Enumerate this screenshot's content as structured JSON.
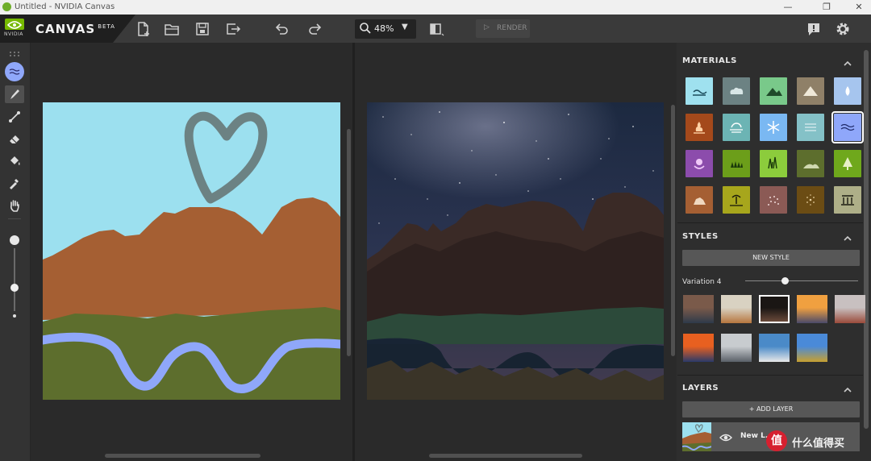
{
  "window": {
    "title": "Untitled - NVIDIA Canvas",
    "min": "—",
    "max": "❐",
    "close": "✕"
  },
  "brand": {
    "vendor": "NVIDIA",
    "name": "CANVAS",
    "tag": "BETA"
  },
  "toolbar": {
    "zoom": "48%",
    "render_label": "RENDER"
  },
  "materials": {
    "title": "MATERIALS",
    "items": [
      {
        "name": "sea",
        "color": "#9fe1ef"
      },
      {
        "name": "cloud",
        "color": "#6c8283"
      },
      {
        "name": "mountain",
        "color": "#79c98a"
      },
      {
        "name": "snowy-mountain",
        "color": "#8f8068"
      },
      {
        "name": "water-drop",
        "color": "#a6c5ee"
      },
      {
        "name": "fire",
        "color": "#a4491b"
      },
      {
        "name": "fog",
        "color": "#6cb4b4"
      },
      {
        "name": "snow",
        "color": "#7ab8f2"
      },
      {
        "name": "river-lines",
        "color": "#84c1c7"
      },
      {
        "name": "water",
        "color": "#8fa7fa"
      },
      {
        "name": "flower",
        "color": "#8c4cac"
      },
      {
        "name": "grass",
        "color": "#6c9e1a"
      },
      {
        "name": "tall-grass",
        "color": "#8ccc3c"
      },
      {
        "name": "hill",
        "color": "#5d6e2d"
      },
      {
        "name": "tree",
        "color": "#6fa81c"
      },
      {
        "name": "rock",
        "color": "#a55f33"
      },
      {
        "name": "beach",
        "color": "#a7a61c"
      },
      {
        "name": "gravel",
        "color": "#8b5a55"
      },
      {
        "name": "dirt",
        "color": "#6b4c14"
      },
      {
        "name": "building",
        "color": "#aeaf88"
      }
    ]
  },
  "styles": {
    "title": "STYLES",
    "new_style": "NEW STYLE",
    "variation_label": "Variation 4",
    "variation_level": 0.35,
    "thumbs": [
      {
        "name": "rocky-sunset",
        "c1": "#7a5a4a",
        "c2": "#2e3a4a"
      },
      {
        "name": "cloud-desert",
        "c1": "#d9d2c2",
        "c2": "#b6763e"
      },
      {
        "name": "cave-arch",
        "c1": "#1a1614",
        "c2": "#6a4a3a"
      },
      {
        "name": "valley-sunset",
        "c1": "#f0a040",
        "c2": "#4a4a6a"
      },
      {
        "name": "red-cliffs",
        "c1": "#c8c0c0",
        "c2": "#9a4a3a"
      },
      {
        "name": "ocean-sunset",
        "c1": "#e86020",
        "c2": "#2a3a6a"
      },
      {
        "name": "snow-peaks",
        "c1": "#c8cccf",
        "c2": "#5a6068"
      },
      {
        "name": "glacier-lake",
        "c1": "#4a8ac8",
        "c2": "#e8e8e8"
      },
      {
        "name": "autumn-valley",
        "c1": "#4a8ad8",
        "c2": "#c8a030"
      }
    ]
  },
  "layers": {
    "title": "LAYERS",
    "add_layer": "+ ADD LAYER",
    "layer_name": "New L...1",
    "watermark": "值 什么值得买"
  }
}
